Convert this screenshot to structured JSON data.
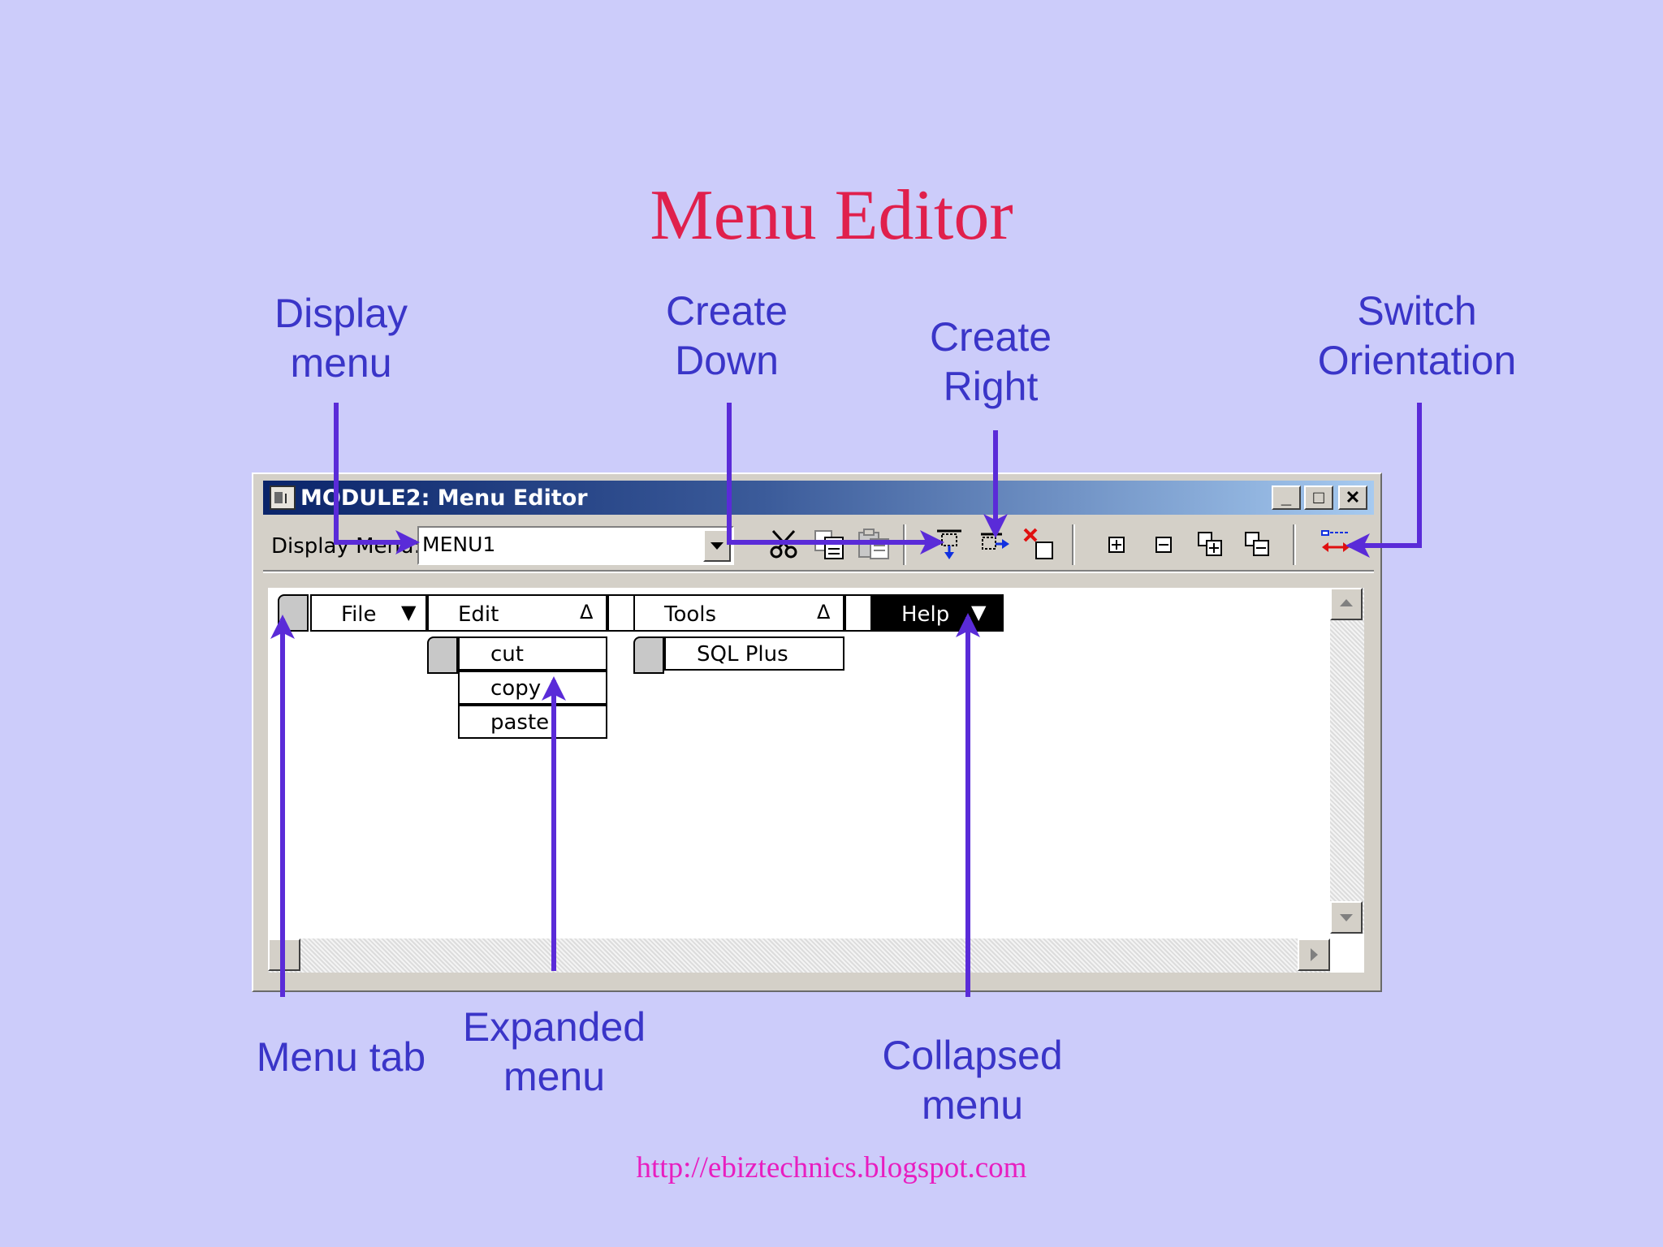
{
  "slide": {
    "title": "Menu Editor",
    "footer_url": "http://ebiztechnics.blogspot.com"
  },
  "callouts": {
    "display_menu": "Display\nmenu",
    "create_down": "Create\nDown",
    "create_right": "Create\nRight",
    "switch_orientation": "Switch\nOrientation",
    "menu_tab": "Menu tab",
    "expanded_menu": "Expanded\nmenu",
    "collapsed_menu": "Collapsed\nmenu"
  },
  "window": {
    "title": "MODULE2: Menu Editor",
    "buttons": {
      "minimize": "_",
      "maximize": "□",
      "close": "✕"
    },
    "toolbar": {
      "display_menu_label": "Display Menu:",
      "display_menu_value": "MENU1",
      "icons": [
        "cut-icon",
        "copy-icon",
        "paste-icon",
        "create-down-icon",
        "create-right-icon",
        "delete-icon",
        "expand-icon",
        "collapse-icon",
        "expand-all-icon",
        "collapse-all-icon",
        "switch-orientation-icon"
      ]
    },
    "menubar": [
      {
        "label": "File",
        "glyph": "▼",
        "state": "collapsed"
      },
      {
        "label": "Edit",
        "glyph": "Δ",
        "state": "expanded"
      },
      {
        "label": "Tools",
        "glyph": "Δ",
        "state": "expanded"
      },
      {
        "label": "Help",
        "glyph": "▼",
        "state": "collapsed",
        "selected": true
      }
    ],
    "edit_submenu": [
      "cut",
      "copy",
      "paste"
    ],
    "tools_submenu": [
      "SQL Plus"
    ]
  },
  "colors": {
    "background": "#ccccfa",
    "title": "#e0204c",
    "callout": "#3a35c8",
    "arrow": "#5a2bd8",
    "footer": "#e81ec0"
  }
}
